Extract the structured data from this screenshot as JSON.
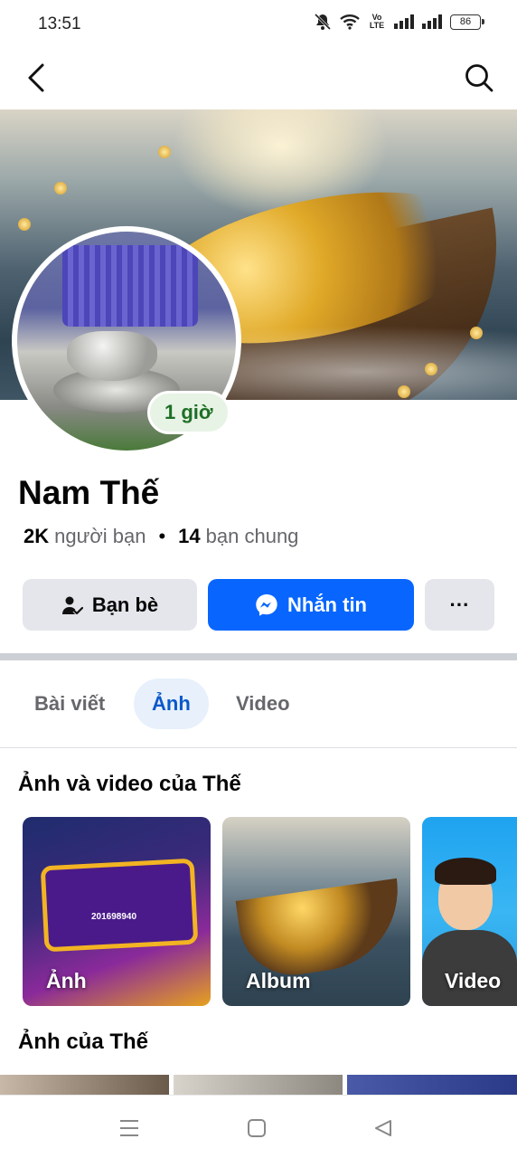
{
  "status_bar": {
    "time": "13:51",
    "volte_label": "Vo\nLTE",
    "battery": "86"
  },
  "profile": {
    "name": "Nam Thế",
    "friends_count": "2K",
    "friends_label": "người bạn",
    "mutual_count": "14",
    "mutual_label": "bạn chung",
    "story_badge": "1 giờ"
  },
  "actions": {
    "friends_label": "Bạn bè",
    "message_label": "Nhắn tin",
    "more_label": "···"
  },
  "tabs": [
    {
      "label": "Bài viết",
      "active": false
    },
    {
      "label": "Ảnh",
      "active": true
    },
    {
      "label": "Video",
      "active": false
    }
  ],
  "media_section": {
    "title": "Ảnh và video của Thế",
    "cards": [
      {
        "label": "Ảnh",
        "overlay_text": "201698940"
      },
      {
        "label": "Album"
      },
      {
        "label": "Video"
      }
    ]
  },
  "photos_section": {
    "title": "Ảnh của Thế"
  },
  "colors": {
    "accent": "#0866ff",
    "active_tab_bg": "#e7f0fb",
    "active_tab_text": "#0a58ca",
    "badge_bg": "#e7f3e5",
    "badge_text": "#1f6f27"
  },
  "icons": {
    "back": "chevron-left-icon",
    "search": "search-icon",
    "friends": "person-check-icon",
    "messenger": "messenger-icon",
    "more": "ellipsis-icon"
  }
}
